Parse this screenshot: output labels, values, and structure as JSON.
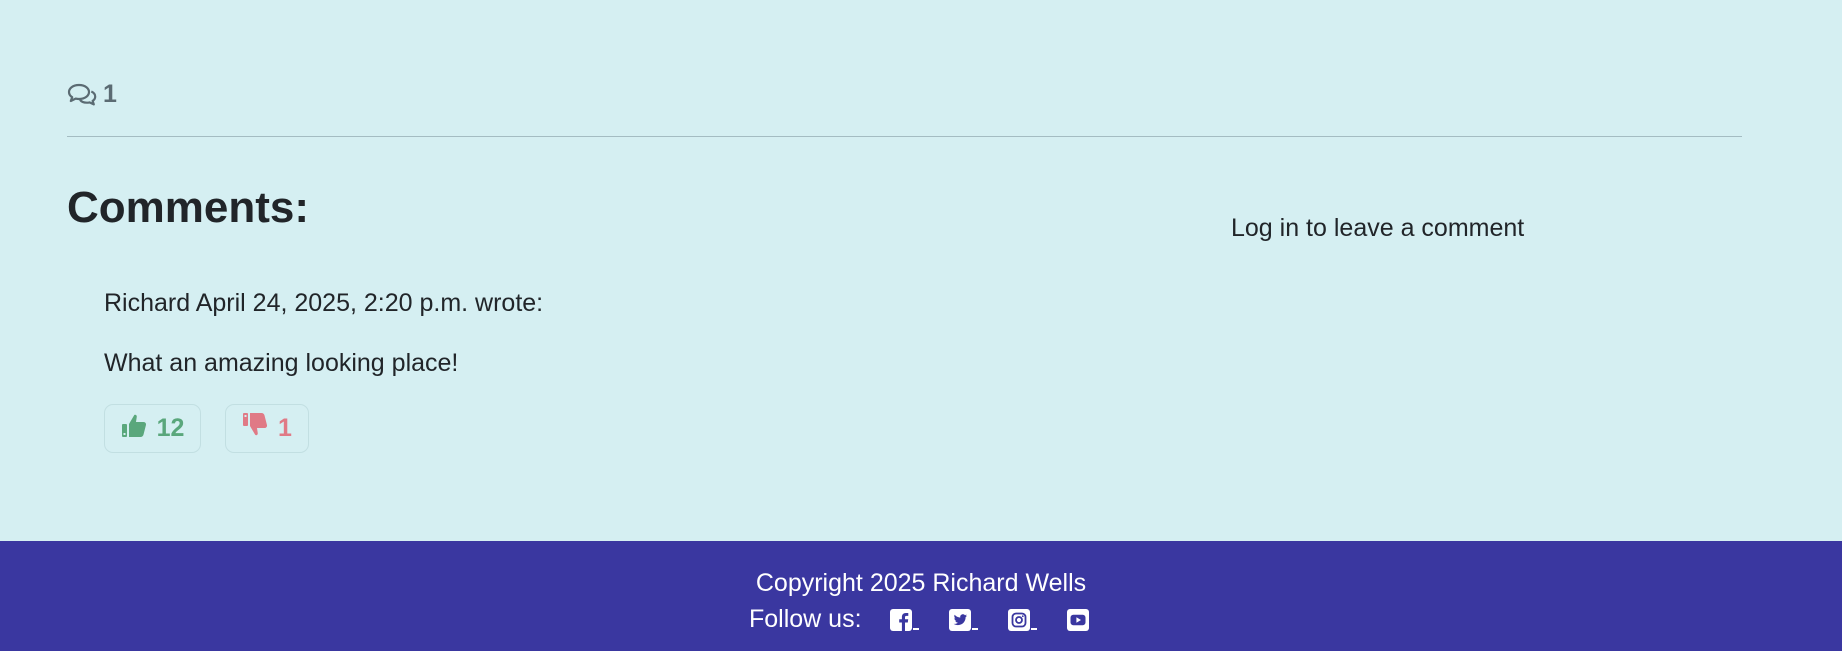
{
  "post": {
    "comment_count": "1",
    "comment_icon": "comments-icon"
  },
  "comments": {
    "heading": "Comments:",
    "login_prompt": "Log in to leave a comment",
    "items": [
      {
        "meta": "Richard April 24, 2025, 2:20 p.m. wrote:",
        "body": "What an amazing looking place!",
        "likes": "12",
        "dislikes": "1"
      }
    ]
  },
  "footer": {
    "copyright": "Copyright 2025 Richard Wells",
    "follow_label": "Follow us:",
    "social_icons": [
      "facebook-icon",
      "twitter-icon",
      "instagram-icon",
      "youtube-icon"
    ]
  },
  "colors": {
    "page_background": "#d5eff2",
    "footer_background": "#3a37a0",
    "like": "#5aa77c",
    "dislike": "#e07a86",
    "muted": "#5b6b73"
  }
}
